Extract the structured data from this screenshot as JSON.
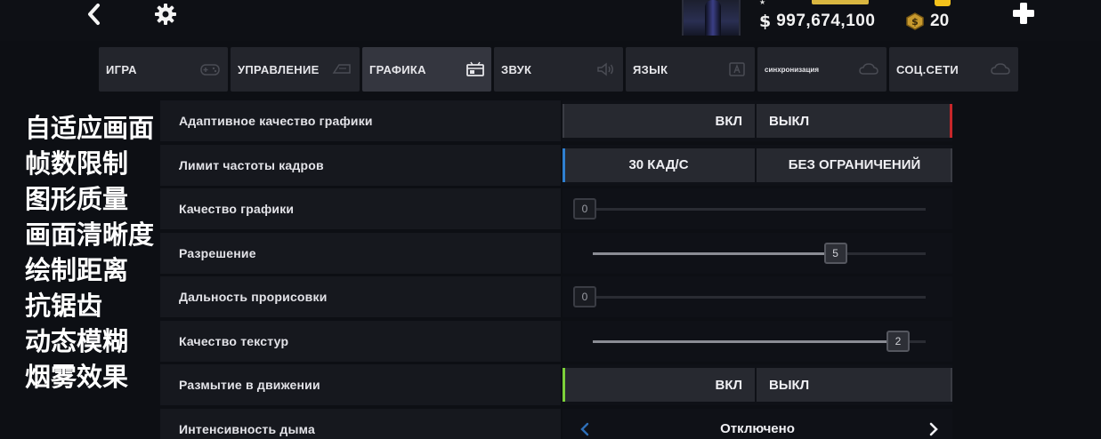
{
  "header": {
    "back_icon": "chevron-left-icon",
    "settings_icon": "gear-icon",
    "money": "997,674,100",
    "money_symbol": "$",
    "coins": "20",
    "plus_icon": "plus-icon"
  },
  "tabs": [
    {
      "label": "ИГРА",
      "icon": "gamepad-icon",
      "active": false
    },
    {
      "label": "УПРАВЛЕНИЕ",
      "icon": "controller-icon",
      "active": false
    },
    {
      "label": "ГРАФИКА",
      "icon": "graphics-icon",
      "active": true
    },
    {
      "label": "ЗВУК",
      "icon": "speaker-icon",
      "active": false
    },
    {
      "label": "ЯЗЫК",
      "icon": "language-icon",
      "active": false
    },
    {
      "label": "синхронизация",
      "icon": "cloud-icon",
      "active": false
    },
    {
      "label": "СОЦ.СЕТИ",
      "icon": "cloud-icon",
      "active": false
    }
  ],
  "overlay_captions": [
    "自适应画面",
    "帧数限制",
    "图形质量",
    "画面清晰度",
    "绘制距离",
    "抗锯齿",
    "动态模糊",
    "烟雾效果"
  ],
  "settings": [
    {
      "label": "Адаптивное качество графики",
      "type": "toggle",
      "left": "ВКЛ",
      "right": "ВЫКЛ",
      "selected": "right"
    },
    {
      "label": "Лимит частоты кадров",
      "type": "toggle",
      "left": "30 КАД/С",
      "right": "БЕЗ ОГРАНИЧЕНИЙ",
      "selected": "left"
    },
    {
      "label": "Качество графики",
      "type": "slider",
      "value": "0",
      "fraction": 0.0
    },
    {
      "label": "Разрешение",
      "type": "slider",
      "value": "5",
      "fraction": 0.8
    },
    {
      "label": "Дальность прорисовки",
      "type": "slider",
      "value": "0",
      "fraction": 0.0
    },
    {
      "label": "Качество текстур",
      "type": "slider",
      "value": "2",
      "fraction": 1.0
    },
    {
      "label": "Размытие в движении",
      "type": "toggle",
      "left": "ВКЛ",
      "right": "ВЫКЛ",
      "selected": "left"
    },
    {
      "label": "Интенсивность дыма",
      "type": "selector",
      "value": "Отключено"
    }
  ],
  "colors": {
    "accent_red": "#c7262a",
    "accent_blue": "#2f7fd0",
    "accent_green": "#7cd13a",
    "gold": "#f4c21c"
  }
}
